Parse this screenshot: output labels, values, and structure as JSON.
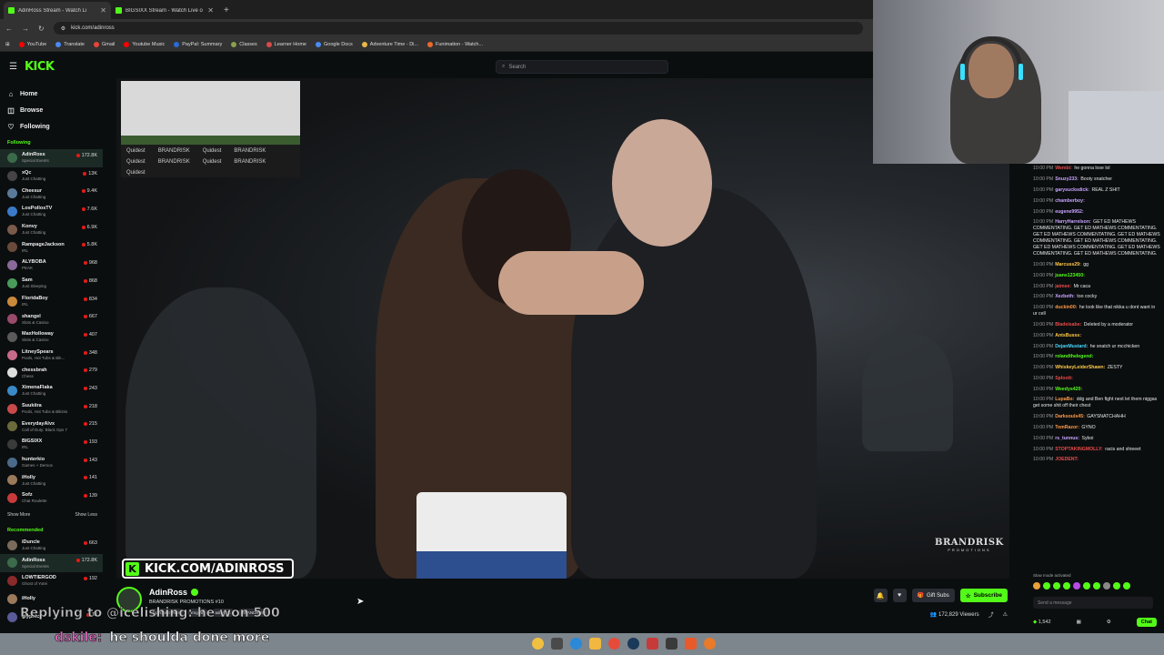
{
  "browser": {
    "tabs": [
      {
        "label": "AdinRoss Stream - Watch Li",
        "active": true
      },
      {
        "label": "BIGSIXX Stream - Watch Live o",
        "active": false
      }
    ],
    "url": "kick.com/adinross",
    "bookmarks": [
      "YouTube",
      "Translate",
      "Gmail",
      "Youtube Music",
      "PayPal: Summary",
      "Classes",
      "Learner Home",
      "Google Docs",
      "Adventure Time - Di...",
      "Funimation - Watch..."
    ]
  },
  "header": {
    "logo": "KICK",
    "search_placeholder": "Search"
  },
  "sidebar": {
    "nav": [
      {
        "label": "Home",
        "icon": "home-icon"
      },
      {
        "label": "Browse",
        "icon": "browse-icon"
      },
      {
        "label": "Following",
        "icon": "heart-icon"
      }
    ],
    "following_title": "Following",
    "following": [
      {
        "name": "AdinRoss",
        "category": "Special Events",
        "viewers": "172.8K",
        "color": "#3b6b4a"
      },
      {
        "name": "xQc",
        "category": "Just Chatting",
        "viewers": "13K",
        "color": "#444"
      },
      {
        "name": "Cheesur",
        "category": "Just Chatting",
        "viewers": "9.4K",
        "color": "#5a7a9a"
      },
      {
        "name": "LosPollosTV",
        "category": "Just Chatting",
        "viewers": "7.6K",
        "color": "#3a7ac8"
      },
      {
        "name": "Konvy",
        "category": "Just Chatting",
        "viewers": "6.9K",
        "color": "#7a5a4a"
      },
      {
        "name": "RampageJackson",
        "category": "IRL",
        "viewers": "5.8K",
        "color": "#6a4a3a"
      },
      {
        "name": "ALYBOBA",
        "category": "PEAK",
        "viewers": "968",
        "color": "#8a6a9a"
      },
      {
        "name": "Sam",
        "category": "Just Sleeping",
        "viewers": "868",
        "color": "#4a9a5a"
      },
      {
        "name": "FloridaBoy",
        "category": "IRL",
        "viewers": "834",
        "color": "#c88a3a"
      },
      {
        "name": "shangel",
        "category": "Slots & Casino",
        "viewers": "667",
        "color": "#9a4a6a"
      },
      {
        "name": "MaxHolloway",
        "category": "Slots & Casino",
        "viewers": "407",
        "color": "#5a5a5a"
      },
      {
        "name": "LitneySpears",
        "category": "Pools, Hot Tubs & Bik...",
        "viewers": "348",
        "color": "#c86a8a"
      },
      {
        "name": "chessbrah",
        "category": "Chess",
        "viewers": "279",
        "color": "#dddddd"
      },
      {
        "name": "XimenaFlaka",
        "category": "Just Chatting",
        "viewers": "243",
        "color": "#3a8ac8"
      },
      {
        "name": "Suukiira",
        "category": "Pools, Hot Tubs & Bikinis",
        "viewers": "218",
        "color": "#c84a4a"
      },
      {
        "name": "EverydayAlvx",
        "category": "Call of Duty: Black Ops 7",
        "viewers": "215",
        "color": "#6a6a3a"
      },
      {
        "name": "BIGSIXX",
        "category": "IRL",
        "viewers": "193",
        "color": "#3a3a3a"
      },
      {
        "name": "hunterkio",
        "category": "Games + Demos",
        "viewers": "143",
        "color": "#4a6a8a"
      },
      {
        "name": "iHolly",
        "category": "Just Chatting",
        "viewers": "141",
        "color": "#9a7a5a"
      },
      {
        "name": "Sofz",
        "category": "Chat Roulette",
        "viewers": "139",
        "color": "#c83a3a"
      }
    ],
    "show_more": "Show More",
    "show_less": "Show Less",
    "recommended_title": "Recommended",
    "recommended": [
      {
        "name": "iDuncle",
        "category": "Just Chatting",
        "viewers": "663",
        "color": "#7a6a5a"
      },
      {
        "name": "AdinRoss",
        "category": "Special Events",
        "viewers": "172.8K",
        "color": "#3b6b4a"
      },
      {
        "name": "LOWTIERGOD",
        "category": "Ghost of Yotei",
        "viewers": "192",
        "color": "#8a2a2a"
      },
      {
        "name": "iHolly",
        "category": "",
        "viewers": "",
        "color": "#9a7a5a"
      },
      {
        "name": "glyphics",
        "category": "",
        "viewers": "13",
        "color": "#5a5a9a"
      }
    ]
  },
  "video": {
    "banner_text": "KICK.COM/ADINROSS",
    "brand_watermark": "BRANDRISK",
    "brand_sub": "PROMOTIONS",
    "pip_logos": [
      "Quidest",
      "BRANDRISK",
      "Quidest",
      "BRANDRISK",
      "Quidest",
      "BRANDRISK",
      "Quidest",
      "BRANDRISK",
      "Quidest"
    ]
  },
  "stream": {
    "streamer": "AdinRoss",
    "title": "BRANDRISK PROMOTIONS #10",
    "tags": [
      "Special Events",
      "English",
      "adinross",
      "BRANDRISK"
    ],
    "gift_label": "Gift Subs",
    "subscribe_label": "Subscribe",
    "viewers": "172,829",
    "viewers_label": "Viewers"
  },
  "chat": {
    "messages": [
      {
        "time": "10:00 PM",
        "user": "Wembi:",
        "color": "#e94a4a",
        "text": "he gonna lose lol"
      },
      {
        "time": "10:00 PM",
        "user": "Snuzy233:",
        "color": "#c8a4ff",
        "text": "Booty snatcher"
      },
      {
        "time": "10:00 PM",
        "user": "garysucksdick:",
        "color": "#c8a4ff",
        "text": "REAL Z SHIT"
      },
      {
        "time": "10:00 PM",
        "user": "chamberboy:",
        "color": "#c8a4ff",
        "text": ""
      },
      {
        "time": "10:00 PM",
        "user": "eugene9952:",
        "color": "#c8a4ff",
        "text": ""
      },
      {
        "time": "10:00 PM",
        "user": "HarryHarrelson:",
        "color": "#c8a4ff",
        "text": "GET ED MATHEWS COMMENTATING. GET ED MATHEWS COMMENTATING. GET ED MATHEWS COMMENTATING. GET ED MATHEWS COMMENTATING. GET ED MATHEWS COMMENTATING. GET ED MATHEWS COMMENTATING. GET ED MATHEWS COMMENTATING. GET ED MATHEWS COMMENTATING."
      },
      {
        "time": "10:00 PM",
        "user": "Marcuss29:",
        "color": "#ffc84a",
        "text": "gg"
      },
      {
        "time": "10:00 PM",
        "user": "juans123450:",
        "color": "#53fc18",
        "text": ""
      },
      {
        "time": "10:00 PM",
        "user": "jaimee:",
        "color": "#e94a4a",
        "text": "Mr caca"
      },
      {
        "time": "10:00 PM",
        "user": "Xezbeth:",
        "color": "#c8a4ff",
        "text": "too cocky"
      },
      {
        "time": "10:00 PM",
        "user": "duckin00:",
        "color": "#ff9a4a",
        "text": "he look like that nikka u dont want in ur cell"
      },
      {
        "time": "10:00 PM",
        "user": "Bladeisabe:",
        "color": "#e94a4a",
        "text": "Deleted by a moderator"
      },
      {
        "time": "10:00 PM",
        "user": "AntsBusss:",
        "color": "#ffc84a",
        "text": ""
      },
      {
        "time": "10:00 PM",
        "user": "DejanMustard:",
        "color": "#4ad8ff",
        "text": "he snatch ur mcchicken"
      },
      {
        "time": "10:00 PM",
        "user": "rolandthelegend:",
        "color": "#53fc18",
        "text": ""
      },
      {
        "time": "10:00 PM",
        "user": "WhiskeyLeiderShawn:",
        "color": "#ffc84a",
        "text": "ZESTY"
      },
      {
        "time": "10:00 PM",
        "user": "Sploott:",
        "color": "#e94a4a",
        "text": ""
      },
      {
        "time": "10:00 PM",
        "user": "Weedys420:",
        "color": "#53fc18",
        "text": ""
      },
      {
        "time": "10:00 PM",
        "user": "LupaBo:",
        "color": "#ff9a4a",
        "text": "ddg and Ben fight next let them niggas get some shit off their chest"
      },
      {
        "time": "10:00 PM",
        "user": "Darksouls45:",
        "color": "#ff9a4a",
        "text": "GAYSNATCHAHH"
      },
      {
        "time": "10:00 PM",
        "user": "TomRazor:",
        "color": "#ff9a4a",
        "text": "GYNO"
      },
      {
        "time": "10:00 PM",
        "user": "rs_tunnus:",
        "color": "#c8a4ff",
        "text": "Syboi"
      },
      {
        "time": "10:00 PM",
        "user": "STOPTAKINGMOLLY:",
        "color": "#e94a4a",
        "text": "racis and shieeet"
      },
      {
        "time": "10:00 PM",
        "user": "JOEDENT:",
        "color": "#e94a4a",
        "text": ""
      }
    ],
    "slow_mode": "Slow mode activated",
    "input_placeholder": "Send a message",
    "points": "1,542",
    "chat_button": "Chat"
  },
  "overlay": {
    "reply_line": "Replying to @icelishing: he won 500",
    "caption_user": "dskile:",
    "caption_msg": "he shoulda done more"
  }
}
